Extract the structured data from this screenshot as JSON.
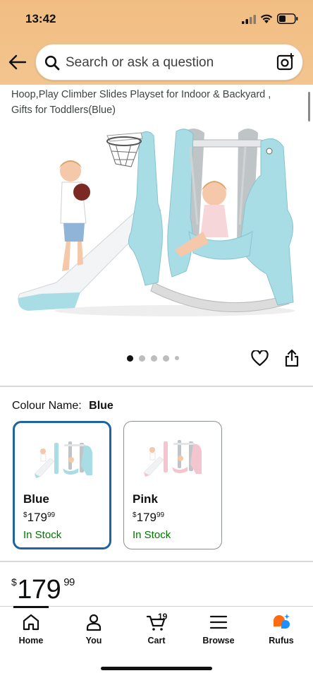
{
  "status_bar": {
    "time": "13:42"
  },
  "search": {
    "placeholder": "Search or ask a question"
  },
  "product": {
    "title": "Hoop,Play Climber Slides Playset for Indoor & Backyard , Gifts for Toddlers(Blue)",
    "image_count": 5,
    "active_image": 1
  },
  "colour": {
    "label": "Colour Name:",
    "selected": "Blue",
    "options": [
      {
        "name": "Blue",
        "currency": "$",
        "price": "179",
        "cents": "99",
        "stock": "In Stock",
        "selected": true
      },
      {
        "name": "Pink",
        "currency": "$",
        "price": "179",
        "cents": "99",
        "stock": "In Stock",
        "selected": false
      }
    ]
  },
  "price": {
    "currency": "$",
    "whole": "179",
    "cents": "99"
  },
  "tab_bar": {
    "items": [
      {
        "label": "Home",
        "icon": "home-icon"
      },
      {
        "label": "You",
        "icon": "person-icon"
      },
      {
        "label": "Cart",
        "icon": "cart-icon",
        "count": "19"
      },
      {
        "label": "Browse",
        "icon": "menu-icon"
      },
      {
        "label": "Rufus",
        "icon": "rufus-icon"
      }
    ]
  },
  "colors": {
    "header": "#f1bd82",
    "selected_border": "#2162a1",
    "in_stock": "#007600",
    "slide_blue": "#a9dde6"
  }
}
